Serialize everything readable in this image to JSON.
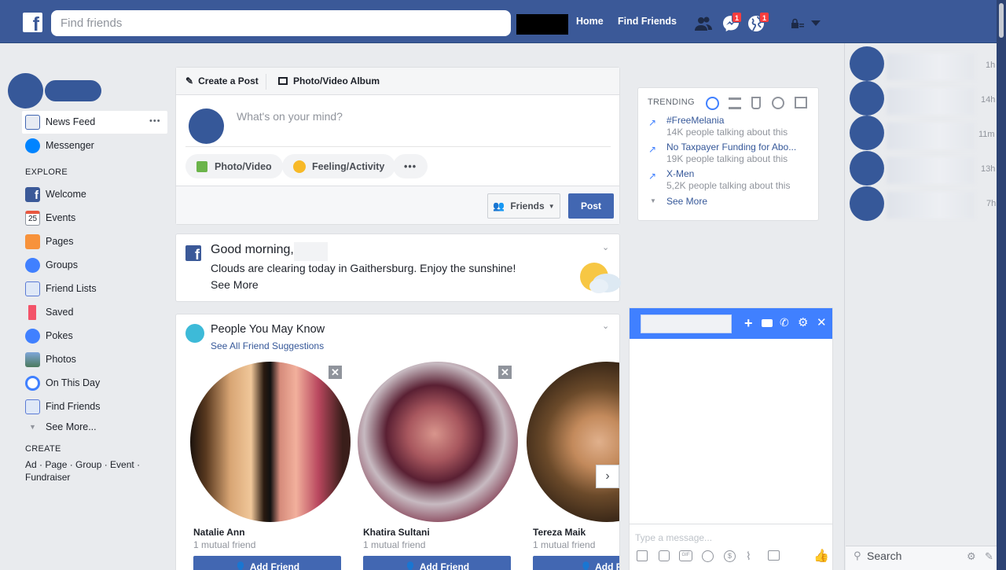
{
  "topbar": {
    "logo": "f",
    "search_placeholder": "Find friends",
    "nav_home": "Home",
    "nav_find_friends": "Find Friends",
    "messenger_badge": "1",
    "notifications_badge": "1"
  },
  "left_nav": {
    "news_feed": "News Feed",
    "news_feed_more": "•••",
    "messenger": "Messenger",
    "explore_heading": "EXPLORE",
    "explore_items": [
      "Welcome",
      "Events",
      "Pages",
      "Groups",
      "Friend Lists",
      "Saved",
      "Pokes",
      "Photos",
      "On This Day",
      "Find Friends"
    ],
    "events_icon_text": "25",
    "see_more": "See More...",
    "create_heading": "CREATE",
    "create_line1": "Ad · Page · Group · Event ·",
    "create_line2": "Fundraiser"
  },
  "composer": {
    "tab_create_post": "Create a Post",
    "tab_photo_album": "Photo/Video Album",
    "placeholder": "What's on your mind?",
    "btn_photo_video": "Photo/Video",
    "btn_feeling": "Feeling/Activity",
    "btn_more": "•••",
    "audience": "Friends",
    "post": "Post"
  },
  "greeting": {
    "title": "Good morning,",
    "text": "Clouds are clearing today in Gaithersburg. Enjoy the sunshine!",
    "see_more": "See More"
  },
  "pymk": {
    "title": "People You May Know",
    "subtitle": "See All Friend Suggestions",
    "people": [
      {
        "name": "Natalie Ann",
        "mutual": "1 mutual friend",
        "add": "Add Friend"
      },
      {
        "name": "Khatira Sultani",
        "mutual": "1 mutual friend",
        "add": "Add Friend"
      },
      {
        "name": "Tereza Maik",
        "mutual": "1 mutual friend",
        "add": "Add Frie"
      }
    ]
  },
  "trending": {
    "heading": "TRENDING",
    "items": [
      {
        "title": "#FreeMelania",
        "sub": "14K people talking about this"
      },
      {
        "title": "No Taxpayer Funding for Abo...",
        "sub": "19K people talking about this"
      },
      {
        "title": "X-Men",
        "sub": "5,2K people talking about this"
      }
    ],
    "see_more": "See More"
  },
  "chat": {
    "input_placeholder": "Type a message..."
  },
  "rail": {
    "times": [
      "1h",
      "14h",
      "11m",
      "13h",
      "7h"
    ],
    "search": "Search"
  },
  "colors": {
    "brand": "#3b5998",
    "button": "#4267b2",
    "messenger": "#4080ff"
  }
}
